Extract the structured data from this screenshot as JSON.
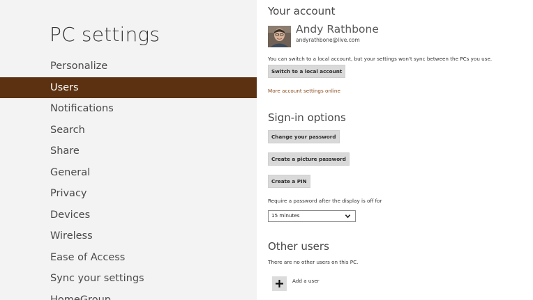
{
  "sidebar": {
    "title": "PC settings",
    "items": [
      {
        "label": "Personalize"
      },
      {
        "label": "Users"
      },
      {
        "label": "Notifications"
      },
      {
        "label": "Search"
      },
      {
        "label": "Share"
      },
      {
        "label": "General"
      },
      {
        "label": "Privacy"
      },
      {
        "label": "Devices"
      },
      {
        "label": "Wireless"
      },
      {
        "label": "Ease of Access"
      },
      {
        "label": "Sync your settings"
      },
      {
        "label": "HomeGroup"
      }
    ],
    "selected": "Users"
  },
  "account": {
    "heading": "Your account",
    "user_name": "Andy Rathbone",
    "user_email": "andyrathbone@live.com",
    "description": "You can switch to a local account, but your settings won't sync between the PCs you use.",
    "switch_button": "Switch to a local account",
    "more_link": "More account settings online"
  },
  "signin": {
    "heading": "Sign-in options",
    "change_password_button": "Change your password",
    "picture_password_button": "Create a picture password",
    "pin_button": "Create a PIN",
    "require_label": "Require a password after the display is off for",
    "require_value": "15 minutes"
  },
  "other_users": {
    "heading": "Other users",
    "description": "There are no other users on this PC.",
    "add_label": "Add a user"
  },
  "colors": {
    "accent": "#5b3111",
    "sidebar_bg": "#f3f3f3",
    "link": "#8a4a1c",
    "button_bg": "#d9d9d9"
  },
  "icons": {
    "dropdown": "chevron-down-icon",
    "add": "plus-icon",
    "avatar": "user-photo"
  }
}
